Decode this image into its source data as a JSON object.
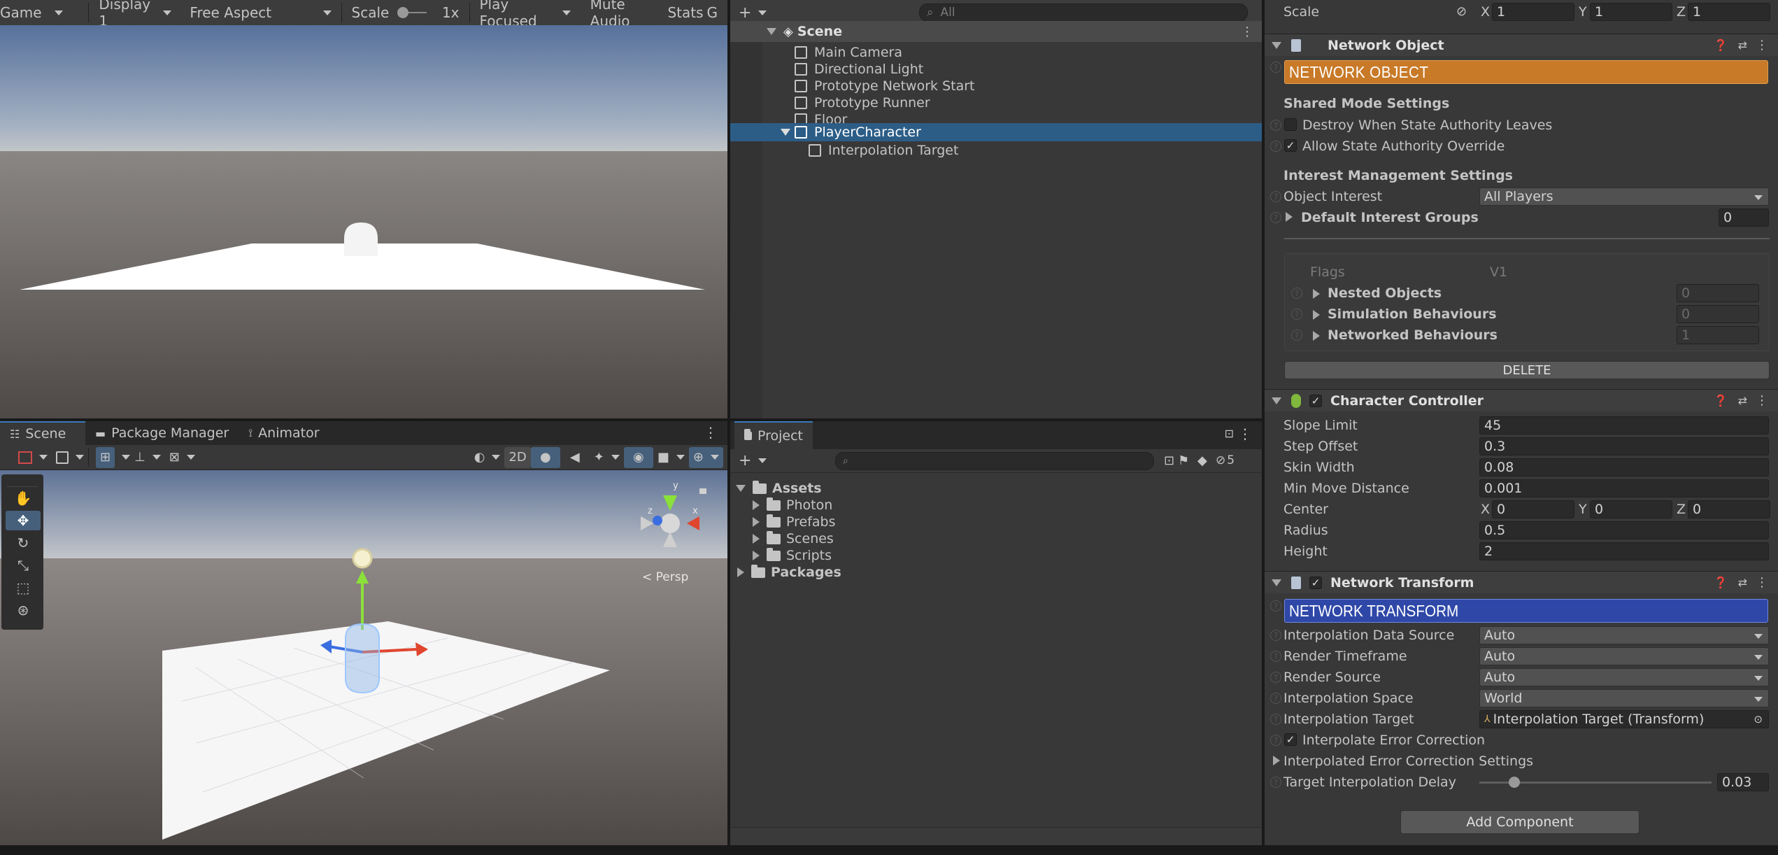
{
  "game_view": {
    "toolbar": {
      "game_tab": "Game",
      "display": "Display 1",
      "aspect": "Free Aspect",
      "scale_label": "Scale",
      "scale_value": "1x",
      "play_mode": "Play Focused",
      "mute": "Mute Audio",
      "stats": "Stats",
      "gizmos": "G"
    }
  },
  "hierarchy": {
    "search_placeholder": "All",
    "root": "Scene",
    "items": [
      "Main Camera",
      "Directional Light",
      "Prototype Network Start",
      "Prototype Runner",
      "Floor",
      "PlayerCharacter"
    ],
    "child": "Interpolation Target"
  },
  "scene_view": {
    "tabs": [
      "Scene",
      "Package Manager",
      "Animator"
    ],
    "mode_2d": "2D",
    "persp": "< Persp",
    "axis_x": "x",
    "axis_y": "y",
    "axis_z": "z"
  },
  "project": {
    "tab": "Project",
    "hidden_count": "5",
    "root": "Assets",
    "folders": [
      "Photon",
      "Prefabs",
      "Scenes",
      "Scripts"
    ],
    "packages": "Packages"
  },
  "inspector": {
    "scale": {
      "label": "Scale",
      "x_lbl": "X",
      "x": "1",
      "y_lbl": "Y",
      "y": "1",
      "z_lbl": "Z",
      "z": "1"
    },
    "network_object": {
      "title": "Network Object",
      "banner": "NETWORK OBJECT",
      "banner_color": "#c87a28",
      "shared_mode": "Shared Mode Settings",
      "destroy": "Destroy When State Authority Leaves",
      "allow": "Allow State Authority Override",
      "interest": "Interest Management Settings",
      "object_interest_label": "Object Interest",
      "object_interest_value": "All Players",
      "default_groups_label": "Default Interest Groups",
      "default_groups_value": "0",
      "flags_label": "Flags",
      "flags_value": "V1",
      "nested_label": "Nested Objects",
      "nested_value": "0",
      "sim_label": "Simulation Behaviours",
      "sim_value": "0",
      "netb_label": "Networked Behaviours",
      "netb_value": "1",
      "delete": "DELETE"
    },
    "character_controller": {
      "title": "Character Controller",
      "slope_label": "Slope Limit",
      "slope": "45",
      "step_label": "Step Offset",
      "step": "0.3",
      "skin_label": "Skin Width",
      "skin": "0.08",
      "minmove_label": "Min Move Distance",
      "minmove": "0.001",
      "center_label": "Center",
      "cx": "0",
      "cy": "0",
      "cz": "0",
      "radius_label": "Radius",
      "radius": "0.5",
      "height_label": "Height",
      "height": "2"
    },
    "network_transform": {
      "title": "Network Transform",
      "banner": "NETWORK TRANSFORM",
      "banner_color": "#2f48a8",
      "ids_label": "Interpolation Data Source",
      "ids": "Auto",
      "rt_label": "Render Timeframe",
      "rt": "Auto",
      "rs_label": "Render Source",
      "rs": "Auto",
      "is_label": "Interpolation Space",
      "is": "World",
      "it_label": "Interpolation Target",
      "it": "Interpolation Target (Transform)",
      "iec_label": "Interpolate Error Correction",
      "iecs_label": "Interpolated Error Correction Settings",
      "tid_label": "Target Interpolation Delay",
      "tid": "0.03",
      "tid_fraction": 0.15
    },
    "add_component": "Add Component"
  }
}
